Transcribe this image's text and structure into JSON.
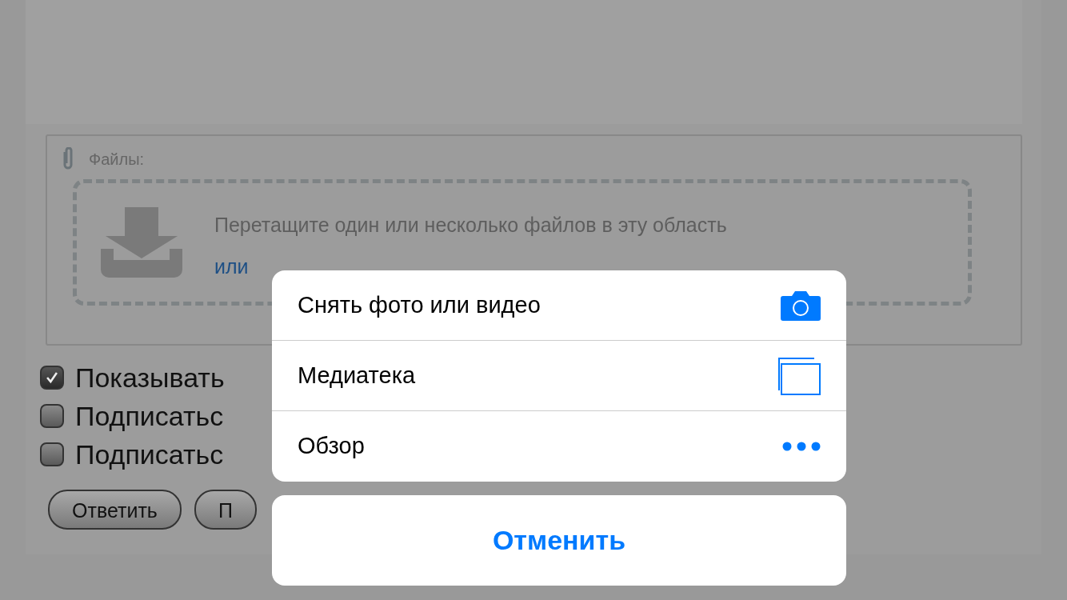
{
  "page": {
    "files_label": "Файлы:",
    "drop_text": "Перетащите один или несколько файлов в эту область",
    "drop_link": "или",
    "checkboxes": [
      {
        "label": "Показывать",
        "checked": true
      },
      {
        "label": "Подписатьс",
        "checked": false
      },
      {
        "label": "Подписатьс",
        "checked": false
      }
    ],
    "buttons": [
      "Ответить",
      "П"
    ]
  },
  "action_sheet": {
    "actions": [
      {
        "label": "Снять фото или видео",
        "kind": "camera"
      },
      {
        "label": "Медиатека",
        "kind": "library"
      },
      {
        "label": "Обзор",
        "kind": "browse"
      }
    ],
    "cancel": "Отменить"
  }
}
